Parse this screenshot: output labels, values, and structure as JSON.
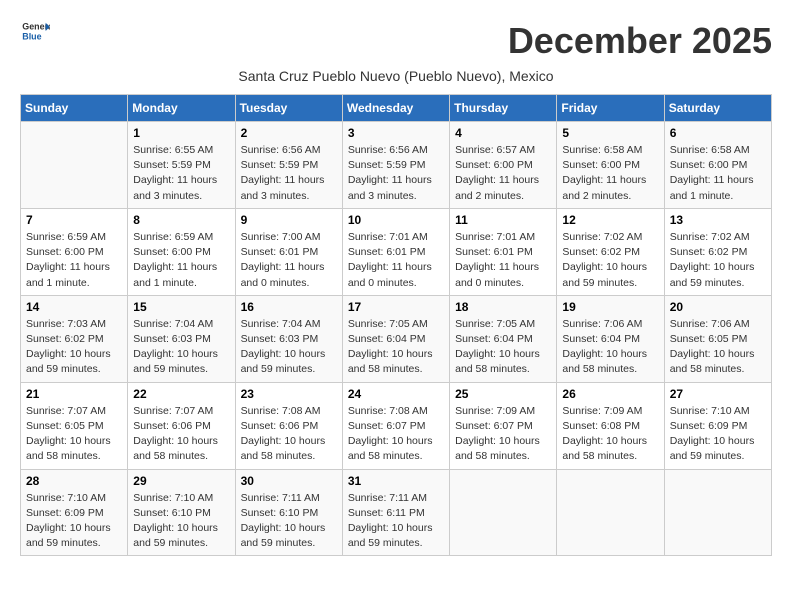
{
  "header": {
    "logo_general": "General",
    "logo_blue": "Blue",
    "month_title": "December 2025",
    "subtitle": "Santa Cruz Pueblo Nuevo (Pueblo Nuevo), Mexico"
  },
  "days_of_week": [
    "Sunday",
    "Monday",
    "Tuesday",
    "Wednesday",
    "Thursday",
    "Friday",
    "Saturday"
  ],
  "weeks": [
    [
      {
        "day": "",
        "info": ""
      },
      {
        "day": "1",
        "info": "Sunrise: 6:55 AM\nSunset: 5:59 PM\nDaylight: 11 hours and 3 minutes."
      },
      {
        "day": "2",
        "info": "Sunrise: 6:56 AM\nSunset: 5:59 PM\nDaylight: 11 hours and 3 minutes."
      },
      {
        "day": "3",
        "info": "Sunrise: 6:56 AM\nSunset: 5:59 PM\nDaylight: 11 hours and 3 minutes."
      },
      {
        "day": "4",
        "info": "Sunrise: 6:57 AM\nSunset: 6:00 PM\nDaylight: 11 hours and 2 minutes."
      },
      {
        "day": "5",
        "info": "Sunrise: 6:58 AM\nSunset: 6:00 PM\nDaylight: 11 hours and 2 minutes."
      },
      {
        "day": "6",
        "info": "Sunrise: 6:58 AM\nSunset: 6:00 PM\nDaylight: 11 hours and 1 minute."
      }
    ],
    [
      {
        "day": "7",
        "info": "Sunrise: 6:59 AM\nSunset: 6:00 PM\nDaylight: 11 hours and 1 minute."
      },
      {
        "day": "8",
        "info": "Sunrise: 6:59 AM\nSunset: 6:00 PM\nDaylight: 11 hours and 1 minute."
      },
      {
        "day": "9",
        "info": "Sunrise: 7:00 AM\nSunset: 6:01 PM\nDaylight: 11 hours and 0 minutes."
      },
      {
        "day": "10",
        "info": "Sunrise: 7:01 AM\nSunset: 6:01 PM\nDaylight: 11 hours and 0 minutes."
      },
      {
        "day": "11",
        "info": "Sunrise: 7:01 AM\nSunset: 6:01 PM\nDaylight: 11 hours and 0 minutes."
      },
      {
        "day": "12",
        "info": "Sunrise: 7:02 AM\nSunset: 6:02 PM\nDaylight: 10 hours and 59 minutes."
      },
      {
        "day": "13",
        "info": "Sunrise: 7:02 AM\nSunset: 6:02 PM\nDaylight: 10 hours and 59 minutes."
      }
    ],
    [
      {
        "day": "14",
        "info": "Sunrise: 7:03 AM\nSunset: 6:02 PM\nDaylight: 10 hours and 59 minutes."
      },
      {
        "day": "15",
        "info": "Sunrise: 7:04 AM\nSunset: 6:03 PM\nDaylight: 10 hours and 59 minutes."
      },
      {
        "day": "16",
        "info": "Sunrise: 7:04 AM\nSunset: 6:03 PM\nDaylight: 10 hours and 59 minutes."
      },
      {
        "day": "17",
        "info": "Sunrise: 7:05 AM\nSunset: 6:04 PM\nDaylight: 10 hours and 58 minutes."
      },
      {
        "day": "18",
        "info": "Sunrise: 7:05 AM\nSunset: 6:04 PM\nDaylight: 10 hours and 58 minutes."
      },
      {
        "day": "19",
        "info": "Sunrise: 7:06 AM\nSunset: 6:04 PM\nDaylight: 10 hours and 58 minutes."
      },
      {
        "day": "20",
        "info": "Sunrise: 7:06 AM\nSunset: 6:05 PM\nDaylight: 10 hours and 58 minutes."
      }
    ],
    [
      {
        "day": "21",
        "info": "Sunrise: 7:07 AM\nSunset: 6:05 PM\nDaylight: 10 hours and 58 minutes."
      },
      {
        "day": "22",
        "info": "Sunrise: 7:07 AM\nSunset: 6:06 PM\nDaylight: 10 hours and 58 minutes."
      },
      {
        "day": "23",
        "info": "Sunrise: 7:08 AM\nSunset: 6:06 PM\nDaylight: 10 hours and 58 minutes."
      },
      {
        "day": "24",
        "info": "Sunrise: 7:08 AM\nSunset: 6:07 PM\nDaylight: 10 hours and 58 minutes."
      },
      {
        "day": "25",
        "info": "Sunrise: 7:09 AM\nSunset: 6:07 PM\nDaylight: 10 hours and 58 minutes."
      },
      {
        "day": "26",
        "info": "Sunrise: 7:09 AM\nSunset: 6:08 PM\nDaylight: 10 hours and 58 minutes."
      },
      {
        "day": "27",
        "info": "Sunrise: 7:10 AM\nSunset: 6:09 PM\nDaylight: 10 hours and 59 minutes."
      }
    ],
    [
      {
        "day": "28",
        "info": "Sunrise: 7:10 AM\nSunset: 6:09 PM\nDaylight: 10 hours and 59 minutes."
      },
      {
        "day": "29",
        "info": "Sunrise: 7:10 AM\nSunset: 6:10 PM\nDaylight: 10 hours and 59 minutes."
      },
      {
        "day": "30",
        "info": "Sunrise: 7:11 AM\nSunset: 6:10 PM\nDaylight: 10 hours and 59 minutes."
      },
      {
        "day": "31",
        "info": "Sunrise: 7:11 AM\nSunset: 6:11 PM\nDaylight: 10 hours and 59 minutes."
      },
      {
        "day": "",
        "info": ""
      },
      {
        "day": "",
        "info": ""
      },
      {
        "day": "",
        "info": ""
      }
    ]
  ]
}
